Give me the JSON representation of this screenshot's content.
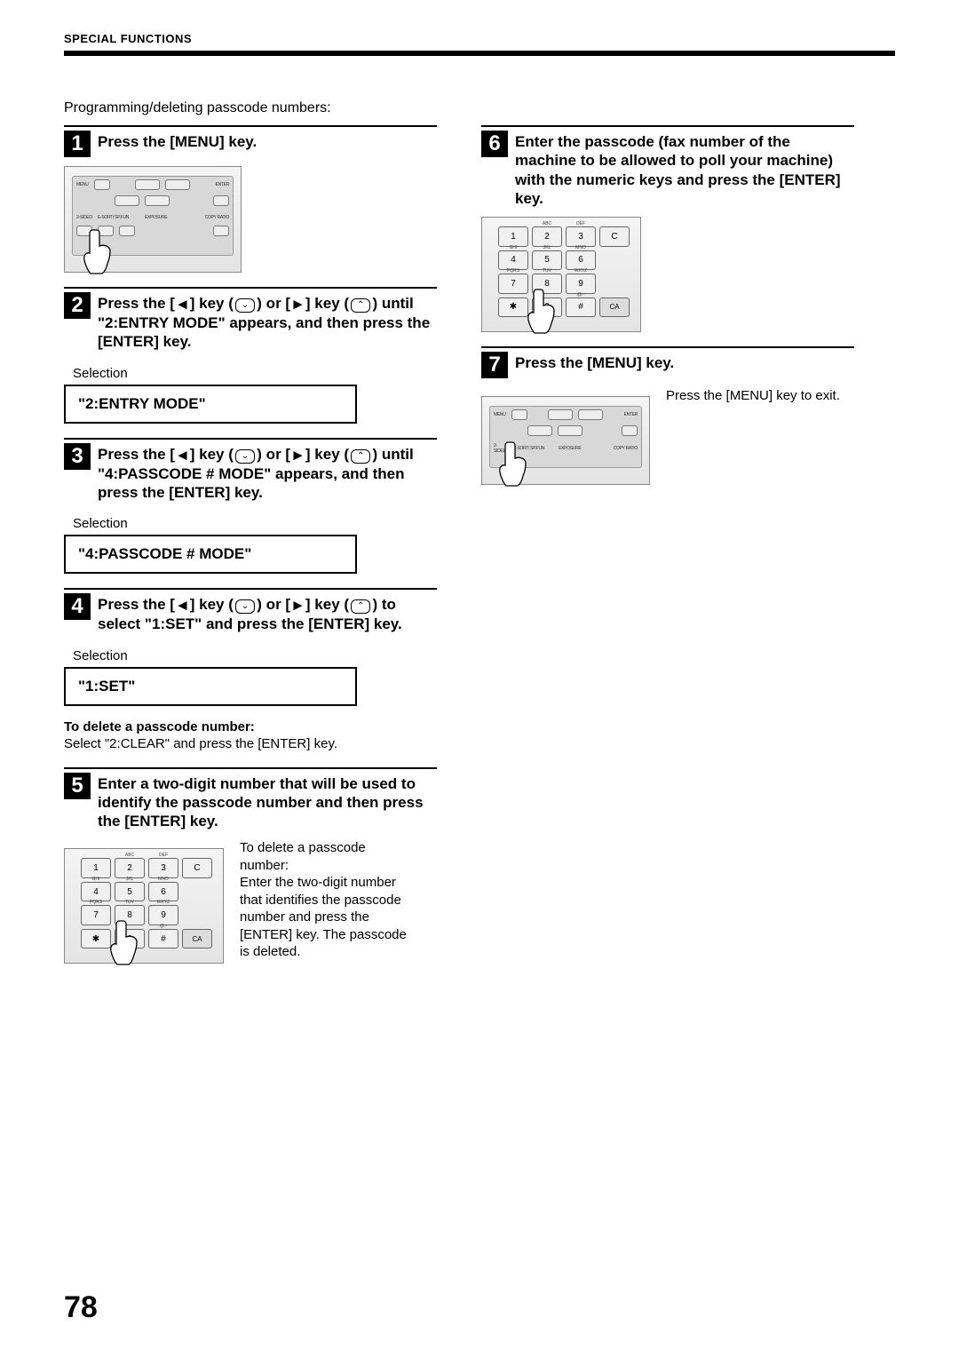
{
  "header": "SPECIAL FUNCTIONS",
  "intro": "Programming/deleting passcode numbers:",
  "page_number": "78",
  "selection_label": "Selection",
  "steps": {
    "s1": {
      "n": "1",
      "title": "Press the [MENU] key."
    },
    "s2": {
      "n": "2",
      "title_a": "Press the [",
      "title_b": "] key (",
      "title_c": ") or [",
      "title_d": "] key (",
      "title_e": ") until \"2:ENTRY MODE\" appears, and then press the [ENTER] key.",
      "selection": "\"2:ENTRY MODE\""
    },
    "s3": {
      "n": "3",
      "title_a": "Press the [",
      "title_b": "] key (",
      "title_c": ") or [",
      "title_d": "] key (",
      "title_e": ") until \"4:PASSCODE # MODE\" appears, and then press the [ENTER] key.",
      "selection": "\"4:PASSCODE # MODE\""
    },
    "s4": {
      "n": "4",
      "title_a": "Press the [",
      "title_b": "] key (",
      "title_c": ") or [",
      "title_d": "] key (",
      "title_e": ") to select \"1:SET\" and press the [ENTER] key.",
      "selection": "\"1:SET\"",
      "note_head": "To delete a passcode number:",
      "note_body": "Select \"2:CLEAR\" and press the [ENTER] key."
    },
    "s5": {
      "n": "5",
      "title": "Enter a two-digit number that will be used to identify the passcode number and then press the [ENTER] key.",
      "note_head": "To delete a passcode number:",
      "note_body": "Enter the two-digit number that identifies the passcode number and press the [ENTER] key. The passcode is deleted."
    },
    "s6": {
      "n": "6",
      "title": "Enter the passcode (fax number of the machine to be allowed to poll your machine) with the numeric keys and press the [ENTER] key."
    },
    "s7": {
      "n": "7",
      "title": "Press the [MENU] key.",
      "note": "Press the [MENU] key to exit."
    }
  },
  "panel_labels": {
    "menu": "MENU",
    "enter": "ENTER",
    "sided": "2-SIDED",
    "esort": "E-SORT/\nSP.FUN",
    "exposure": "EXPOSURE",
    "copyratio": "COPY\nRATIO"
  },
  "keypad": {
    "r1": [
      {
        "t": "1",
        "sup": ""
      },
      {
        "t": "2",
        "sup": "ABC"
      },
      {
        "t": "3",
        "sup": "DEF"
      },
      {
        "t": "C",
        "sup": ""
      }
    ],
    "r2": [
      {
        "t": "4",
        "sup": "GHI"
      },
      {
        "t": "5",
        "sup": "JKL"
      },
      {
        "t": "6",
        "sup": "MNO"
      },
      {
        "t": "",
        "sup": ""
      }
    ],
    "r3": [
      {
        "t": "7",
        "sup": "PQRS"
      },
      {
        "t": "8",
        "sup": "TUV"
      },
      {
        "t": "9",
        "sup": "WXYZ"
      },
      {
        "t": "",
        "sup": ""
      }
    ],
    "r4": [
      {
        "t": "✱",
        "sup": ""
      },
      {
        "t": "0",
        "sup": ""
      },
      {
        "t": "#",
        "sup": "@.-"
      },
      {
        "t": "CA",
        "sup": ""
      }
    ]
  }
}
